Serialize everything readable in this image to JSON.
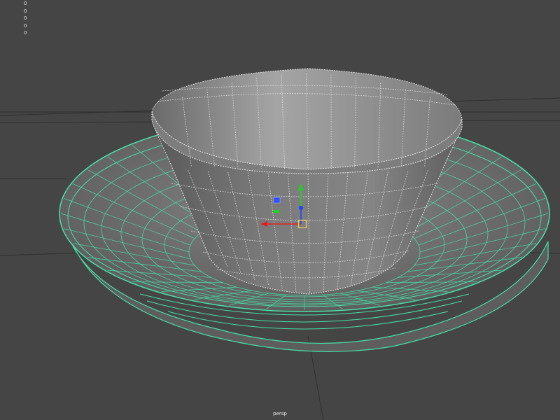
{
  "hud": {
    "stats": [
      "0",
      "0",
      "0",
      "0",
      "0"
    ]
  },
  "viewport": {
    "camera_name": "persp",
    "background_color": "#454545",
    "grid_color": "#2f2f2f",
    "selected_wire_color": "#47e0a8",
    "unselected_wire_color": "#e0e0e0"
  },
  "scene": {
    "objects": [
      {
        "name": "cup",
        "selected": false,
        "icon": "cup-mesh"
      },
      {
        "name": "saucer",
        "selected": true,
        "icon": "plate-mesh"
      }
    ]
  },
  "manipulator": {
    "x_axis_color": "#e02020",
    "y_axis_color": "#20d020",
    "z_axis_color": "#2040ff",
    "center_color": "#f0d060"
  }
}
